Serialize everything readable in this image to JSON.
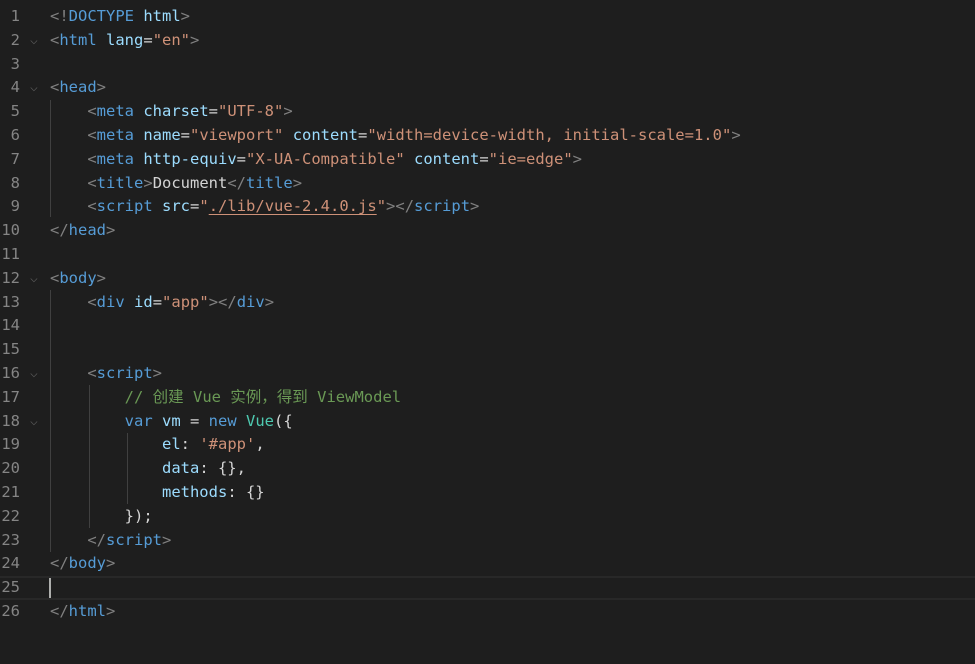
{
  "editor": {
    "current_line": 25,
    "lines": [
      {
        "num": "1",
        "fold": "",
        "tokens": [
          [
            "punc",
            "<!"
          ],
          [
            "tag",
            "DOCTYPE"
          ],
          [
            "text",
            " "
          ],
          [
            "attr",
            "html"
          ],
          [
            "punc",
            ">"
          ]
        ]
      },
      {
        "num": "2",
        "fold": "⌵",
        "tokens": [
          [
            "punc",
            "<"
          ],
          [
            "tag",
            "html"
          ],
          [
            "text",
            " "
          ],
          [
            "attr",
            "lang"
          ],
          [
            "text",
            "="
          ],
          [
            "str",
            "\"en\""
          ],
          [
            "punc",
            ">"
          ]
        ]
      },
      {
        "num": "3",
        "fold": "",
        "tokens": []
      },
      {
        "num": "4",
        "fold": "⌵",
        "tokens": [
          [
            "punc",
            "<"
          ],
          [
            "tag",
            "head"
          ],
          [
            "punc",
            ">"
          ]
        ]
      },
      {
        "num": "5",
        "fold": "",
        "tokens": [
          [
            "text",
            "    "
          ],
          [
            "punc",
            "<"
          ],
          [
            "tag",
            "meta"
          ],
          [
            "text",
            " "
          ],
          [
            "attr",
            "charset"
          ],
          [
            "text",
            "="
          ],
          [
            "str",
            "\"UTF-8\""
          ],
          [
            "punc",
            ">"
          ]
        ]
      },
      {
        "num": "6",
        "fold": "",
        "tokens": [
          [
            "text",
            "    "
          ],
          [
            "punc",
            "<"
          ],
          [
            "tag",
            "meta"
          ],
          [
            "text",
            " "
          ],
          [
            "attr",
            "name"
          ],
          [
            "text",
            "="
          ],
          [
            "str",
            "\"viewport\""
          ],
          [
            "text",
            " "
          ],
          [
            "attr",
            "content"
          ],
          [
            "text",
            "="
          ],
          [
            "str",
            "\"width=device-width, initial-scale=1.0\""
          ],
          [
            "punc",
            ">"
          ]
        ]
      },
      {
        "num": "7",
        "fold": "",
        "tokens": [
          [
            "text",
            "    "
          ],
          [
            "punc",
            "<"
          ],
          [
            "tag",
            "meta"
          ],
          [
            "text",
            " "
          ],
          [
            "attr",
            "http-equiv"
          ],
          [
            "text",
            "="
          ],
          [
            "str",
            "\"X-UA-Compatible\""
          ],
          [
            "text",
            " "
          ],
          [
            "attr",
            "content"
          ],
          [
            "text",
            "="
          ],
          [
            "str",
            "\"ie=edge\""
          ],
          [
            "punc",
            ">"
          ]
        ]
      },
      {
        "num": "8",
        "fold": "",
        "tokens": [
          [
            "text",
            "    "
          ],
          [
            "punc",
            "<"
          ],
          [
            "tag",
            "title"
          ],
          [
            "punc",
            ">"
          ],
          [
            "text",
            "Document"
          ],
          [
            "punc",
            "</"
          ],
          [
            "tag",
            "title"
          ],
          [
            "punc",
            ">"
          ]
        ]
      },
      {
        "num": "9",
        "fold": "",
        "tokens": [
          [
            "text",
            "    "
          ],
          [
            "punc",
            "<"
          ],
          [
            "tag",
            "script"
          ],
          [
            "text",
            " "
          ],
          [
            "attr",
            "src"
          ],
          [
            "text",
            "="
          ],
          [
            "str",
            "\""
          ],
          [
            "link",
            "./lib/vue-2.4.0.js"
          ],
          [
            "str",
            "\""
          ],
          [
            "punc",
            "></"
          ],
          [
            "tag",
            "script"
          ],
          [
            "punc",
            ">"
          ]
        ]
      },
      {
        "num": "10",
        "fold": "",
        "tokens": [
          [
            "punc",
            "</"
          ],
          [
            "tag",
            "head"
          ],
          [
            "punc",
            ">"
          ]
        ]
      },
      {
        "num": "11",
        "fold": "",
        "tokens": []
      },
      {
        "num": "12",
        "fold": "⌵",
        "tokens": [
          [
            "punc",
            "<"
          ],
          [
            "tag",
            "body"
          ],
          [
            "punc",
            ">"
          ]
        ]
      },
      {
        "num": "13",
        "fold": "",
        "tokens": [
          [
            "text",
            "    "
          ],
          [
            "punc",
            "<"
          ],
          [
            "tag",
            "div"
          ],
          [
            "text",
            " "
          ],
          [
            "attr",
            "id"
          ],
          [
            "text",
            "="
          ],
          [
            "str",
            "\"app\""
          ],
          [
            "punc",
            "></"
          ],
          [
            "tag",
            "div"
          ],
          [
            "punc",
            ">"
          ]
        ]
      },
      {
        "num": "14",
        "fold": "",
        "tokens": []
      },
      {
        "num": "15",
        "fold": "",
        "tokens": []
      },
      {
        "num": "16",
        "fold": "⌵",
        "tokens": [
          [
            "text",
            "    "
          ],
          [
            "punc",
            "<"
          ],
          [
            "tag",
            "script"
          ],
          [
            "punc",
            ">"
          ]
        ]
      },
      {
        "num": "17",
        "fold": "",
        "tokens": [
          [
            "text",
            "        "
          ],
          [
            "comm",
            "// 创建 Vue 实例，得到 ViewModel"
          ]
        ]
      },
      {
        "num": "18",
        "fold": "⌵",
        "tokens": [
          [
            "text",
            "        "
          ],
          [
            "kw",
            "var"
          ],
          [
            "text",
            " "
          ],
          [
            "attr",
            "vm"
          ],
          [
            "text",
            " = "
          ],
          [
            "kw",
            "new"
          ],
          [
            "text",
            " "
          ],
          [
            "fn",
            "Vue"
          ],
          [
            "text",
            "({"
          ]
        ]
      },
      {
        "num": "19",
        "fold": "",
        "tokens": [
          [
            "text",
            "            "
          ],
          [
            "attr",
            "el"
          ],
          [
            "text",
            ": "
          ],
          [
            "str",
            "'#app'"
          ],
          [
            "text",
            ","
          ]
        ]
      },
      {
        "num": "20",
        "fold": "",
        "tokens": [
          [
            "text",
            "            "
          ],
          [
            "attr",
            "data"
          ],
          [
            "text",
            ": {},"
          ]
        ]
      },
      {
        "num": "21",
        "fold": "",
        "tokens": [
          [
            "text",
            "            "
          ],
          [
            "attr",
            "methods"
          ],
          [
            "text",
            ": {}"
          ]
        ]
      },
      {
        "num": "22",
        "fold": "",
        "tokens": [
          [
            "text",
            "        });"
          ]
        ]
      },
      {
        "num": "23",
        "fold": "",
        "tokens": [
          [
            "text",
            "    "
          ],
          [
            "punc",
            "</"
          ],
          [
            "tag",
            "script"
          ],
          [
            "punc",
            ">"
          ]
        ]
      },
      {
        "num": "24",
        "fold": "",
        "tokens": [
          [
            "punc",
            "</"
          ],
          [
            "tag",
            "body"
          ],
          [
            "punc",
            ">"
          ]
        ]
      },
      {
        "num": "25",
        "fold": "",
        "tokens": []
      },
      {
        "num": "26",
        "fold": "",
        "tokens": [
          [
            "punc",
            "</"
          ],
          [
            "tag",
            "html"
          ],
          [
            "punc",
            ">"
          ]
        ]
      }
    ]
  }
}
